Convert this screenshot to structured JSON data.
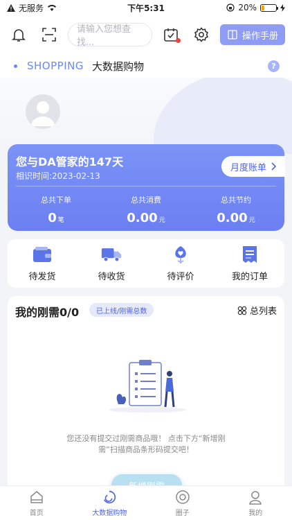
{
  "status_bar": {
    "carrier": "无服务",
    "time": "下午5:31",
    "battery_percent": "20%",
    "battery_level": 0.2
  },
  "top_bar": {
    "search_placeholder": "请输入您想查找...",
    "manual_label": "操作手册",
    "accent_color": "#8f9cf3"
  },
  "section": {
    "title_en": "SHOPPING",
    "title_cn": "大数据购物",
    "help_label": "?"
  },
  "card": {
    "days_text": "您与DA管家的147天",
    "date_text": "相识时间:2023-02-13",
    "monthly_label": "月度账单",
    "stats": [
      {
        "label": "总共下单",
        "value": "0",
        "unit": "笔"
      },
      {
        "label": "总共消费",
        "value": "0.00",
        "unit": "元"
      },
      {
        "label": "总共节约",
        "value": "0.00",
        "unit": "元"
      }
    ]
  },
  "orders": [
    {
      "label": "待发货",
      "icon": "wallet-icon"
    },
    {
      "label": "待收货",
      "icon": "truck-icon"
    },
    {
      "label": "待评价",
      "icon": "flower-icon"
    },
    {
      "label": "我的订单",
      "icon": "receipt-icon"
    }
  ],
  "needs": {
    "title": "我的刚需0/0",
    "badge": "已上线/刚需总数",
    "list_label": "总列表",
    "empty_text": "您还没有提交过刚需商品哦！ 点击下方“新增刚需”扫描商品条形码提交吧！",
    "add_label": "新增刚需"
  },
  "tabbar": [
    {
      "label": "首页",
      "icon": "home-icon"
    },
    {
      "label": "大数据购物",
      "icon": "shopping-icon",
      "active": true
    },
    {
      "label": "圈子",
      "icon": "circle-icon"
    },
    {
      "label": "我的",
      "icon": "profile-icon"
    }
  ]
}
